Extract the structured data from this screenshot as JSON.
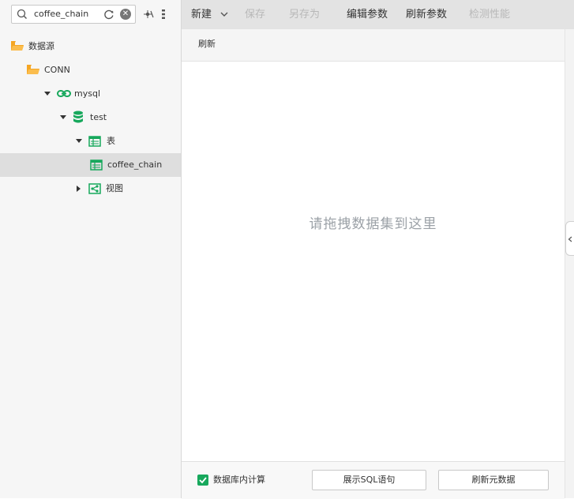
{
  "search": {
    "value": "coffee_chain"
  },
  "tree": {
    "root": "数据源",
    "conn": "CONN",
    "db": "mysql",
    "schema": "test",
    "tables_folder": "表",
    "table": "coffee_chain",
    "views_folder": "视图"
  },
  "toolbar": {
    "new": "新建",
    "save": "保存",
    "save_as": "另存为",
    "edit_params": "编辑参数",
    "refresh_params": "刷新参数",
    "check_perf": "检测性能"
  },
  "subbar": {
    "refresh": "刷新"
  },
  "drop_hint": "请拖拽数据集到这里",
  "bottom": {
    "in_db_calc": "数据库内计算",
    "in_db_calc_checked": true,
    "show_sql": "展示SQL语句",
    "refresh_meta": "刷新元数据"
  },
  "colors": {
    "accent": "#17a85c",
    "folder": "#f5a623",
    "toolbar_bg": "#e3e3e3"
  }
}
